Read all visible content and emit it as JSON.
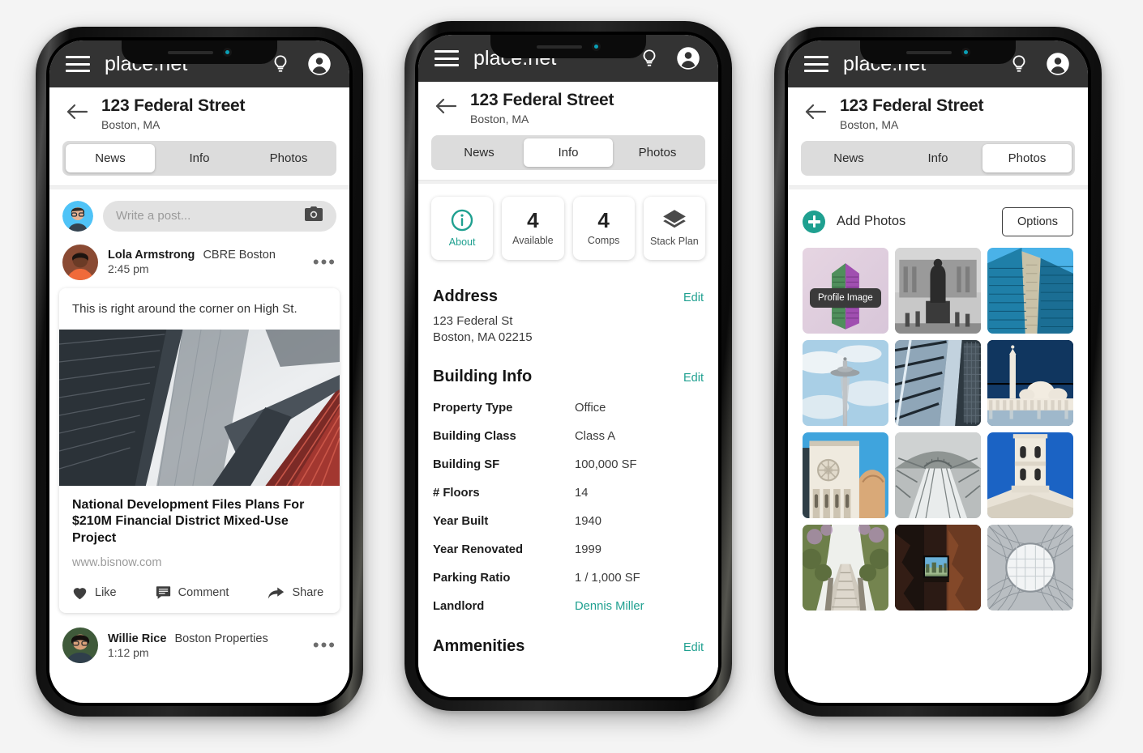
{
  "appbar": {
    "brand": "place.net",
    "menu_icon": "hamburger-icon",
    "bulb_icon": "lightbulb-icon",
    "account_icon": "account-avatar-icon"
  },
  "property": {
    "title": "123 Federal Street",
    "subtitle": "Boston, MA"
  },
  "tabs": [
    {
      "label": "News"
    },
    {
      "label": "Info"
    },
    {
      "label": "Photos"
    }
  ],
  "phone1": {
    "active_tab": "News",
    "composer": {
      "placeholder": "Write a post...",
      "camera_icon": "camera-icon"
    },
    "posts": [
      {
        "author": "Lola Armstrong",
        "org": "CBRE Boston",
        "time": "2:45 pm",
        "text": "This is right around the corner on High St.",
        "link_title": "National Development Files Plans For $210M Financial District Mixed-Use Project",
        "link_url": "www.bisnow.com",
        "actions": [
          {
            "label": "Like",
            "icon": "heart-icon"
          },
          {
            "label": "Comment",
            "icon": "comment-icon"
          },
          {
            "label": "Share",
            "icon": "share-arrow-icon"
          }
        ]
      },
      {
        "author": "Willie Rice",
        "org": "Boston Properties",
        "time": "1:12 pm"
      }
    ]
  },
  "phone2": {
    "active_tab": "Info",
    "tiles": [
      {
        "value": "",
        "label": "About",
        "icon": "info-circle-icon",
        "accent": true
      },
      {
        "value": "4",
        "label": "Available",
        "icon": "",
        "accent": false
      },
      {
        "value": "4",
        "label": "Comps",
        "icon": "",
        "accent": false
      },
      {
        "value": "",
        "label": "Stack Plan",
        "icon": "layers-icon",
        "accent": false
      }
    ],
    "address_section": {
      "title": "Address",
      "edit": "Edit",
      "line1": "123 Federal St",
      "line2": "Boston, MA 02215"
    },
    "building_section": {
      "title": "Building Info",
      "edit": "Edit",
      "rows": [
        {
          "key": "Property Type",
          "value": "Office"
        },
        {
          "key": "Building Class",
          "value": "Class A"
        },
        {
          "key": "Building SF",
          "value": "100,000 SF"
        },
        {
          "key": "# Floors",
          "value": "14"
        },
        {
          "key": "Year Built",
          "value": "1940"
        },
        {
          "key": "Year Renovated",
          "value": "1999"
        },
        {
          "key": "Parking Ratio",
          "value": "1 / 1,000 SF"
        },
        {
          "key": "Landlord",
          "value": "Dennis Miller",
          "link": true
        }
      ]
    },
    "amenities_section": {
      "title": "Ammenities",
      "edit": "Edit"
    }
  },
  "phone3": {
    "active_tab": "Photos",
    "toolbar": {
      "add_label": "Add Photos",
      "add_icon": "plus-circle-icon",
      "options_label": "Options"
    },
    "photos": [
      {
        "alt": "colorful-highrise-tower",
        "badge": "Profile Image"
      },
      {
        "alt": "statue-monochrome-plaza",
        "badge": ""
      },
      {
        "alt": "blue-glass-skyscrapers",
        "badge": ""
      },
      {
        "alt": "space-needle-clouds",
        "badge": ""
      },
      {
        "alt": "glass-facade-diagonal",
        "badge": ""
      },
      {
        "alt": "white-mosque-minaret",
        "badge": ""
      },
      {
        "alt": "florence-cathedral-facade",
        "badge": ""
      },
      {
        "alt": "snowy-suspension-bridge",
        "badge": ""
      },
      {
        "alt": "stone-tower-blue-sky",
        "badge": ""
      },
      {
        "alt": "tree-lined-boardwalk",
        "badge": ""
      },
      {
        "alt": "cave-window-city-view",
        "badge": ""
      },
      {
        "alt": "lattice-dome-ceiling",
        "badge": ""
      }
    ]
  },
  "colors": {
    "accent_teal": "#1fa090",
    "appbar": "#333333",
    "page_bg": "#f4f4f4"
  }
}
